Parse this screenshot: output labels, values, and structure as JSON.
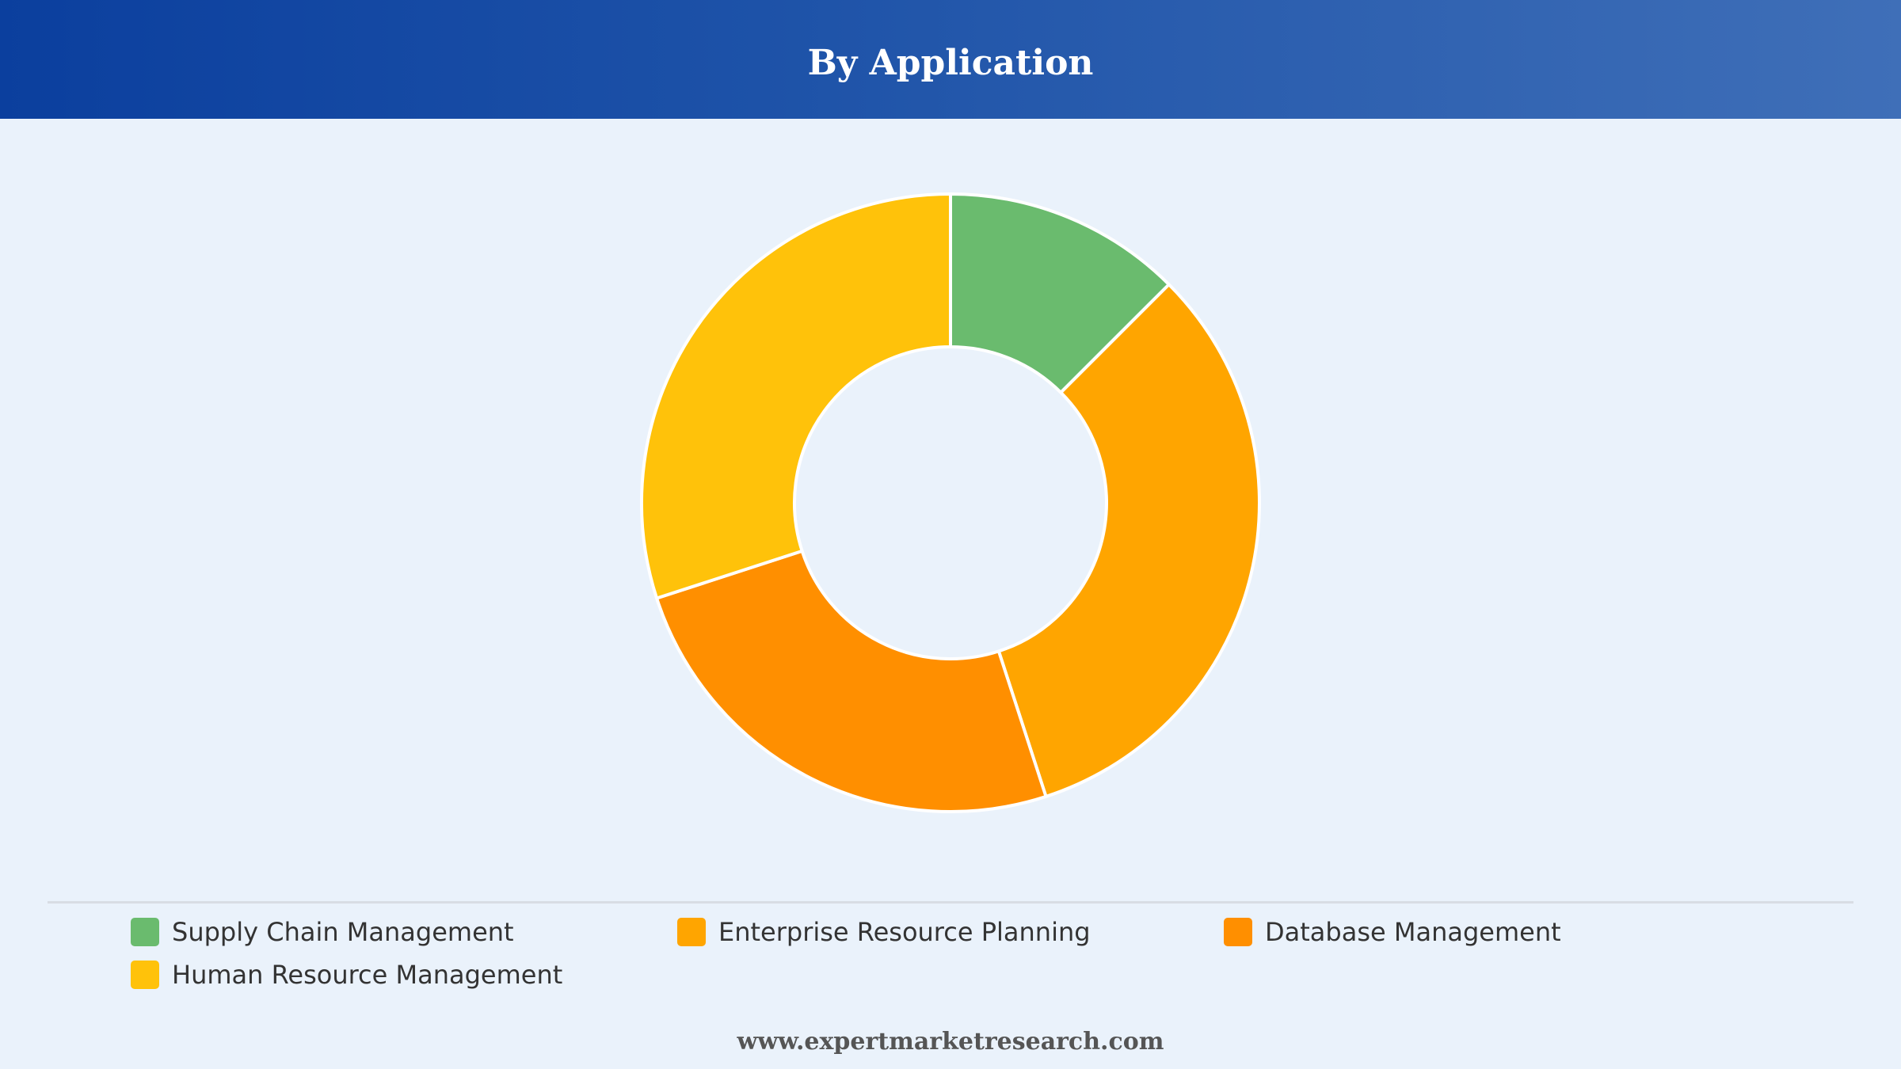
{
  "header": {
    "title": "By Application"
  },
  "chart_data": {
    "type": "pie",
    "title": "By Application",
    "donut": true,
    "categories": [
      "Supply Chain Management",
      "Enterprise Resource Planning",
      "Database Management",
      "Human Resource Management"
    ],
    "values": [
      12.5,
      32.5,
      25.0,
      30.0
    ],
    "colors": [
      "#6abb6e",
      "#ffa500",
      "#ff8f00",
      "#ffc20a"
    ],
    "legend_position": "bottom"
  },
  "legend": {
    "items": [
      {
        "label": "Supply Chain Management",
        "color": "#6abb6e"
      },
      {
        "label": "Enterprise Resource Planning",
        "color": "#ffa500"
      },
      {
        "label": "Database Management",
        "color": "#ff8f00"
      },
      {
        "label": "Human Resource Management",
        "color": "#ffc20a"
      }
    ]
  },
  "footer": {
    "website": "www.expertmarketresearch.com"
  }
}
